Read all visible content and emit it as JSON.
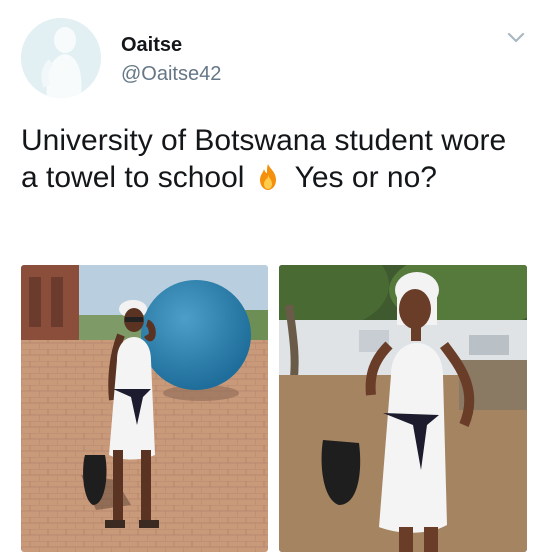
{
  "user": {
    "name": "Oaitse",
    "handle": "@Oaitse42"
  },
  "tweet": {
    "text_before_emoji": "University of Botswana student wore a towel to school",
    "text_after_emoji": "Yes or no?",
    "emoji": "fire-icon"
  },
  "menu": {
    "icon": "chevron-down-icon"
  },
  "media": [
    {
      "name": "photo-left"
    },
    {
      "name": "photo-right"
    }
  ],
  "colors": {
    "text": "#14171a",
    "secondary": "#657786",
    "chevron": "#aab8c2",
    "fire": "#f4900c"
  }
}
